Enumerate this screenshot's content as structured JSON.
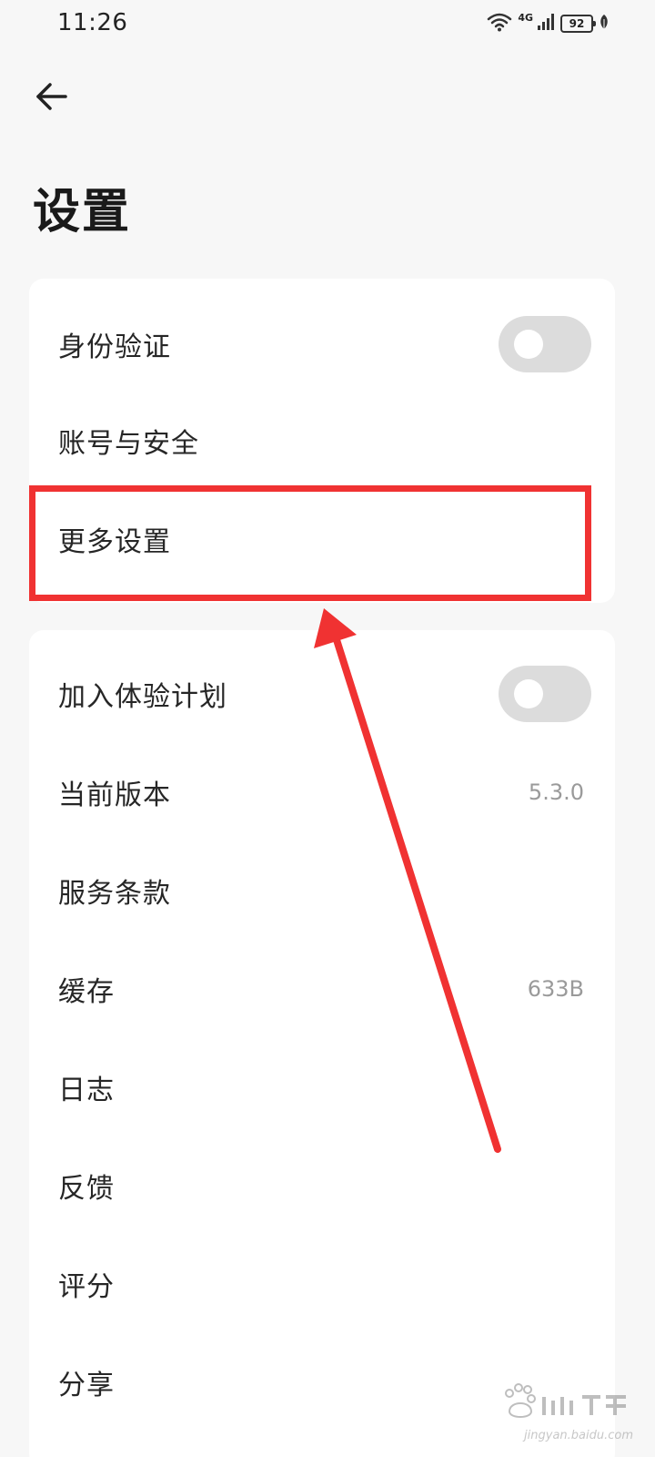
{
  "status_bar": {
    "time": "11:26",
    "network": "4G",
    "battery": "92"
  },
  "header": {
    "back_icon": "arrow-left-icon",
    "title": "设置"
  },
  "group1": {
    "items": [
      {
        "label": "身份验证",
        "control": "toggle",
        "toggle_on": false
      },
      {
        "label": "账号与安全"
      },
      {
        "label": "更多设置"
      }
    ]
  },
  "group2": {
    "items": [
      {
        "label": "加入体验计划",
        "control": "toggle",
        "toggle_on": false
      },
      {
        "label": "当前版本",
        "value": "5.3.0"
      },
      {
        "label": "服务条款"
      },
      {
        "label": "缓存",
        "value": "633B"
      },
      {
        "label": "日志"
      },
      {
        "label": "反馈"
      },
      {
        "label": "评分"
      },
      {
        "label": "分享"
      }
    ]
  },
  "annotation": {
    "color": "#f03232",
    "highlighted_item": "更多设置"
  },
  "watermark": {
    "logo": "baidu-jingyan-logo",
    "text": "jingyan.baidu.com"
  },
  "colors": {
    "background": "#f7f7f7",
    "card": "#ffffff",
    "toggle_off": "#dcdcdc",
    "value_text": "#9a9a9a"
  }
}
